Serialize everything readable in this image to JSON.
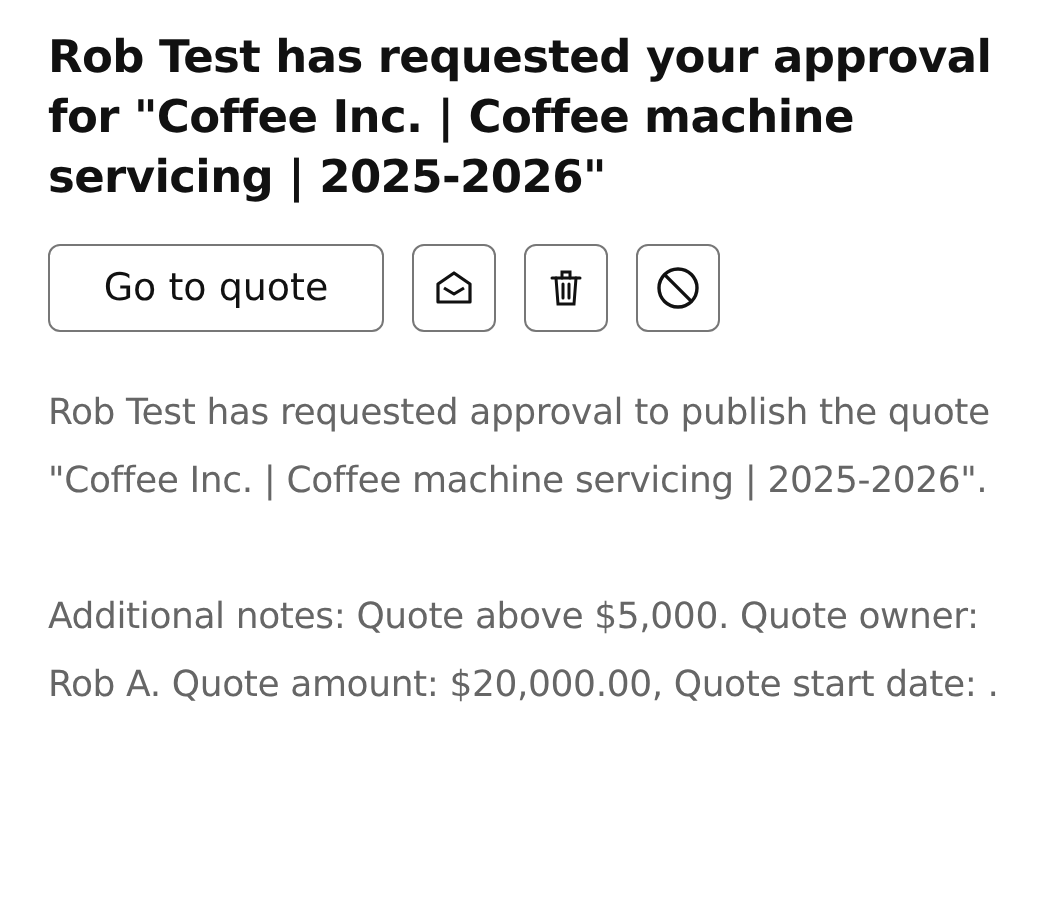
{
  "title": "Rob Test has requested your approval for \"Coffee Inc. | Coffee machine servicing | 2025-2026\"",
  "actions": [
    {
      "kind": "text",
      "label": "Go to quote"
    },
    {
      "kind": "mail"
    },
    {
      "kind": "trash"
    },
    {
      "kind": "block"
    }
  ],
  "paragraphs": [
    "Rob Test has requested approval to publish the quote \"Coffee Inc. | Coffee machine servicing | 2025-2026\".",
    "Additional notes: Quote above $5,000. Quote owner: Rob A. Quote amount: $20,000.00, Quote start date: ."
  ]
}
